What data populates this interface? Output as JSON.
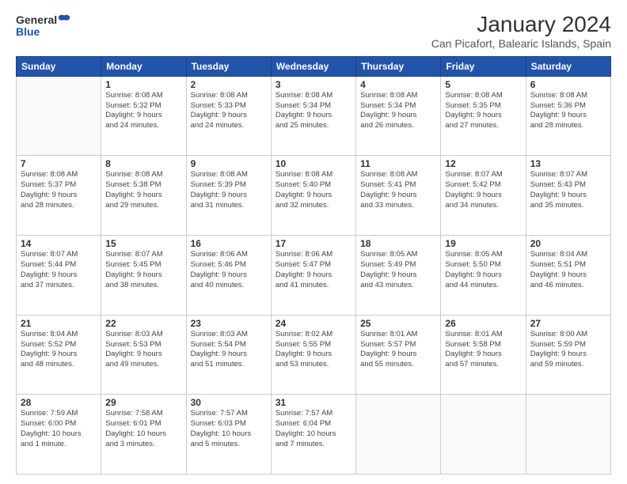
{
  "logo": {
    "general": "General",
    "blue": "Blue"
  },
  "title": "January 2024",
  "subtitle": "Can Picafort, Balearic Islands, Spain",
  "days_of_week": [
    "Sunday",
    "Monday",
    "Tuesday",
    "Wednesday",
    "Thursday",
    "Friday",
    "Saturday"
  ],
  "weeks": [
    [
      {
        "day": "",
        "info": ""
      },
      {
        "day": "1",
        "info": "Sunrise: 8:08 AM\nSunset: 5:32 PM\nDaylight: 9 hours\nand 24 minutes."
      },
      {
        "day": "2",
        "info": "Sunrise: 8:08 AM\nSunset: 5:33 PM\nDaylight: 9 hours\nand 24 minutes."
      },
      {
        "day": "3",
        "info": "Sunrise: 8:08 AM\nSunset: 5:34 PM\nDaylight: 9 hours\nand 25 minutes."
      },
      {
        "day": "4",
        "info": "Sunrise: 8:08 AM\nSunset: 5:34 PM\nDaylight: 9 hours\nand 26 minutes."
      },
      {
        "day": "5",
        "info": "Sunrise: 8:08 AM\nSunset: 5:35 PM\nDaylight: 9 hours\nand 27 minutes."
      },
      {
        "day": "6",
        "info": "Sunrise: 8:08 AM\nSunset: 5:36 PM\nDaylight: 9 hours\nand 28 minutes."
      }
    ],
    [
      {
        "day": "7",
        "info": "Sunrise: 8:08 AM\nSunset: 5:37 PM\nDaylight: 9 hours\nand 28 minutes."
      },
      {
        "day": "8",
        "info": "Sunrise: 8:08 AM\nSunset: 5:38 PM\nDaylight: 9 hours\nand 29 minutes."
      },
      {
        "day": "9",
        "info": "Sunrise: 8:08 AM\nSunset: 5:39 PM\nDaylight: 9 hours\nand 31 minutes."
      },
      {
        "day": "10",
        "info": "Sunrise: 8:08 AM\nSunset: 5:40 PM\nDaylight: 9 hours\nand 32 minutes."
      },
      {
        "day": "11",
        "info": "Sunrise: 8:08 AM\nSunset: 5:41 PM\nDaylight: 9 hours\nand 33 minutes."
      },
      {
        "day": "12",
        "info": "Sunrise: 8:07 AM\nSunset: 5:42 PM\nDaylight: 9 hours\nand 34 minutes."
      },
      {
        "day": "13",
        "info": "Sunrise: 8:07 AM\nSunset: 5:43 PM\nDaylight: 9 hours\nand 35 minutes."
      }
    ],
    [
      {
        "day": "14",
        "info": "Sunrise: 8:07 AM\nSunset: 5:44 PM\nDaylight: 9 hours\nand 37 minutes."
      },
      {
        "day": "15",
        "info": "Sunrise: 8:07 AM\nSunset: 5:45 PM\nDaylight: 9 hours\nand 38 minutes."
      },
      {
        "day": "16",
        "info": "Sunrise: 8:06 AM\nSunset: 5:46 PM\nDaylight: 9 hours\nand 40 minutes."
      },
      {
        "day": "17",
        "info": "Sunrise: 8:06 AM\nSunset: 5:47 PM\nDaylight: 9 hours\nand 41 minutes."
      },
      {
        "day": "18",
        "info": "Sunrise: 8:05 AM\nSunset: 5:49 PM\nDaylight: 9 hours\nand 43 minutes."
      },
      {
        "day": "19",
        "info": "Sunrise: 8:05 AM\nSunset: 5:50 PM\nDaylight: 9 hours\nand 44 minutes."
      },
      {
        "day": "20",
        "info": "Sunrise: 8:04 AM\nSunset: 5:51 PM\nDaylight: 9 hours\nand 46 minutes."
      }
    ],
    [
      {
        "day": "21",
        "info": "Sunrise: 8:04 AM\nSunset: 5:52 PM\nDaylight: 9 hours\nand 48 minutes."
      },
      {
        "day": "22",
        "info": "Sunrise: 8:03 AM\nSunset: 5:53 PM\nDaylight: 9 hours\nand 49 minutes."
      },
      {
        "day": "23",
        "info": "Sunrise: 8:03 AM\nSunset: 5:54 PM\nDaylight: 9 hours\nand 51 minutes."
      },
      {
        "day": "24",
        "info": "Sunrise: 8:02 AM\nSunset: 5:55 PM\nDaylight: 9 hours\nand 53 minutes."
      },
      {
        "day": "25",
        "info": "Sunrise: 8:01 AM\nSunset: 5:57 PM\nDaylight: 9 hours\nand 55 minutes."
      },
      {
        "day": "26",
        "info": "Sunrise: 8:01 AM\nSunset: 5:58 PM\nDaylight: 9 hours\nand 57 minutes."
      },
      {
        "day": "27",
        "info": "Sunrise: 8:00 AM\nSunset: 5:59 PM\nDaylight: 9 hours\nand 59 minutes."
      }
    ],
    [
      {
        "day": "28",
        "info": "Sunrise: 7:59 AM\nSunset: 6:00 PM\nDaylight: 10 hours\nand 1 minute."
      },
      {
        "day": "29",
        "info": "Sunrise: 7:58 AM\nSunset: 6:01 PM\nDaylight: 10 hours\nand 3 minutes."
      },
      {
        "day": "30",
        "info": "Sunrise: 7:57 AM\nSunset: 6:03 PM\nDaylight: 10 hours\nand 5 minutes."
      },
      {
        "day": "31",
        "info": "Sunrise: 7:57 AM\nSunset: 6:04 PM\nDaylight: 10 hours\nand 7 minutes."
      },
      {
        "day": "",
        "info": ""
      },
      {
        "day": "",
        "info": ""
      },
      {
        "day": "",
        "info": ""
      }
    ]
  ]
}
